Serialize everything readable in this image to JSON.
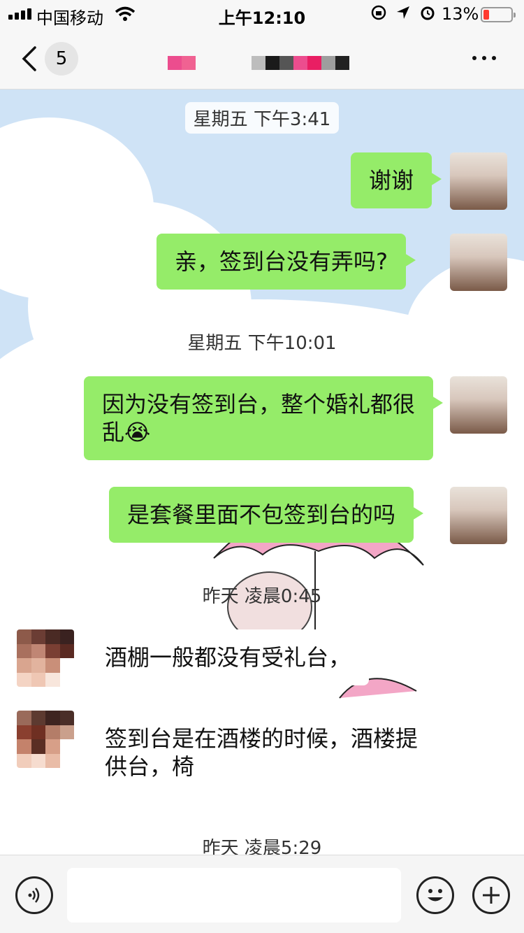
{
  "status_bar": {
    "carrier": "中国移动",
    "time": "上午12:10",
    "battery_percent": "13%",
    "battery_level": 0.13,
    "battery_color": "#ff3b30"
  },
  "nav": {
    "unread_count": "5",
    "back_icon": "chevron-left-icon",
    "more_icon": "more-dots-icon"
  },
  "chat": {
    "messages": [
      {
        "type": "time",
        "text": "星期五 下午3:41"
      },
      {
        "type": "me",
        "text": "谢谢"
      },
      {
        "type": "me",
        "text": "亲，签到台没有弄吗?"
      },
      {
        "type": "time",
        "text": "星期五 下午10:01"
      },
      {
        "type": "me",
        "text": "因为没有签到台，整个婚礼都很乱",
        "emoji": "😭"
      },
      {
        "type": "me",
        "text": "是套餐里面不包签到台的吗"
      },
      {
        "type": "time",
        "text": "昨天 凌晨0:45"
      },
      {
        "type": "other",
        "text": "酒棚一般都没有受礼台，"
      },
      {
        "type": "other",
        "text": "签到台是在酒楼的时候，酒楼提供台，椅"
      },
      {
        "type": "time",
        "text": "昨天 凌晨5:29"
      }
    ]
  },
  "input_bar": {
    "voice_icon": "voice-icon",
    "emoji_icon": "emoji-icon",
    "plus_icon": "plus-icon",
    "value": ""
  },
  "colors": {
    "bubble_me": "#95ec69",
    "bubble_other": "#ffffff",
    "chat_bg_sky": "#cfe3f6"
  }
}
